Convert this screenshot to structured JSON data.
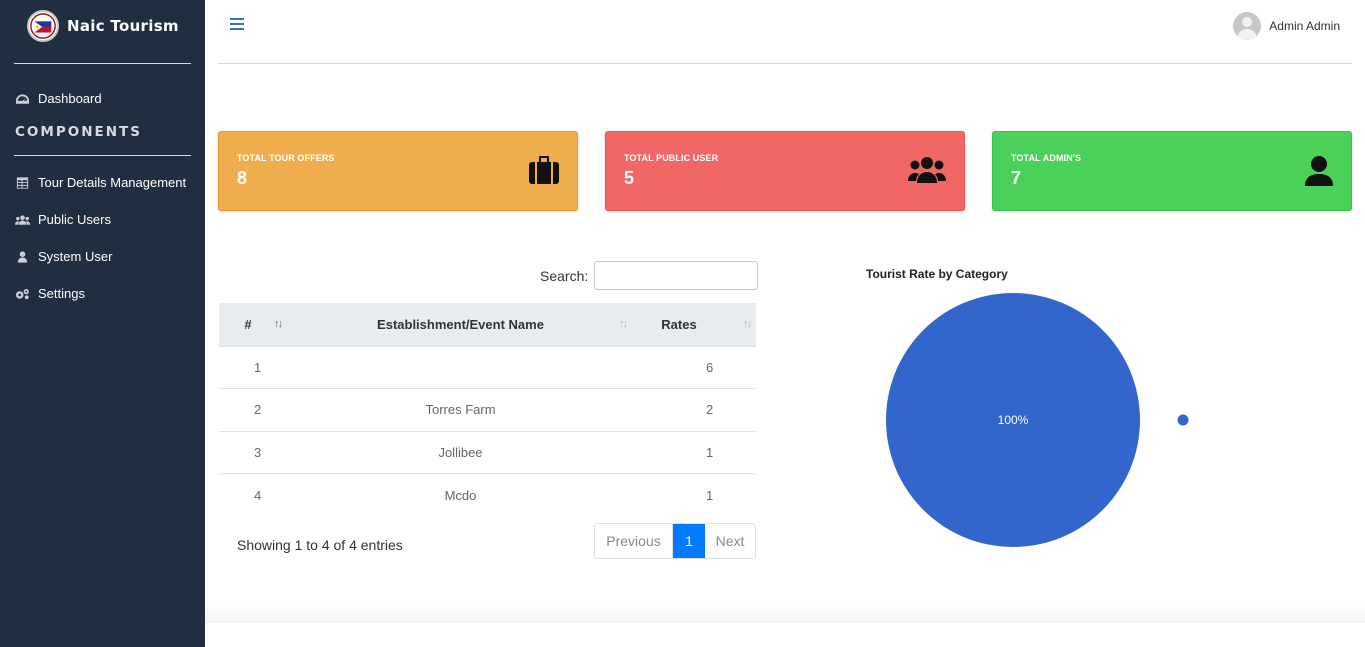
{
  "brand": {
    "name": "Naic Tourism"
  },
  "sidebar": {
    "dashboard": "Dashboard",
    "heading": "COMPONENTS",
    "items": [
      {
        "label": "Tour Details Management",
        "icon": "table-icon"
      },
      {
        "label": "Public Users",
        "icon": "users-icon"
      },
      {
        "label": "System User",
        "icon": "user-icon"
      },
      {
        "label": "Settings",
        "icon": "cogs-icon"
      }
    ]
  },
  "topbar": {
    "user_name": "Admin Admin"
  },
  "cards": [
    {
      "title": "TOTAL TOUR OFFERS",
      "value": "8",
      "color": "#f0ad4e",
      "icon": "briefcase-icon"
    },
    {
      "title": "TOTAL PUBLIC USER",
      "value": "5",
      "color": "#f06766",
      "icon": "users-icon"
    },
    {
      "title": "TOTAL ADMIN'S",
      "value": "7",
      "color": "#49d15a",
      "icon": "user-icon"
    }
  ],
  "table": {
    "search_label": "Search:",
    "columns": [
      "#",
      "Establishment/Event Name",
      "Rates"
    ],
    "rows": [
      [
        "1",
        "",
        "6"
      ],
      [
        "2",
        "Torres Farm",
        "2"
      ],
      [
        "3",
        "Jollibee",
        "1"
      ],
      [
        "4",
        "Mcdo",
        "1"
      ]
    ],
    "info": "Showing 1 to 4 of 4 entries",
    "pager": {
      "previous": "Previous",
      "current": "1",
      "next": "Next"
    }
  },
  "chart_data": {
    "type": "pie",
    "title": "Tourist Rate by Category",
    "slices": [
      {
        "label": "",
        "value": 100,
        "color": "#3366cc"
      }
    ],
    "slice_label": "100%"
  }
}
